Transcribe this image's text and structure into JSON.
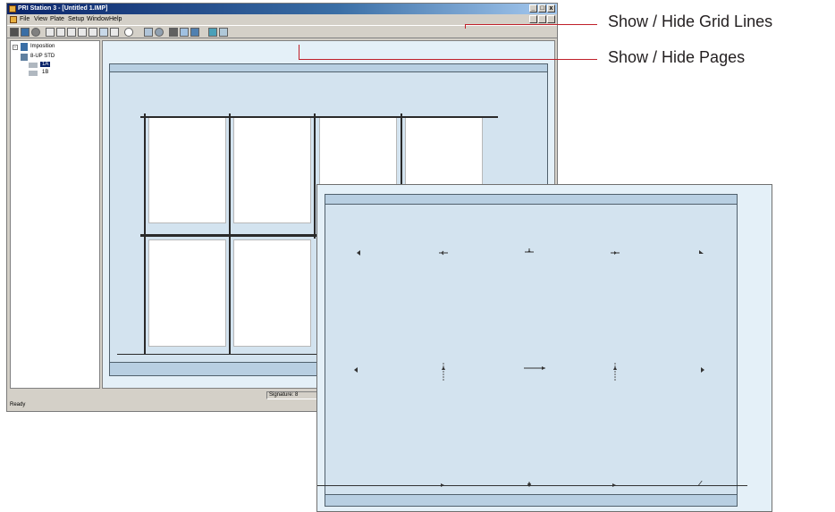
{
  "window": {
    "title": "PRI Station 3 - [Untitled 1.IMP]",
    "menu": [
      "File",
      "View",
      "Plate",
      "Setup",
      "Window",
      "Help"
    ],
    "controls": {
      "minimize": "_",
      "maximize": "□",
      "close": "x"
    }
  },
  "tree": {
    "root": "Imposition",
    "sheet": "8-UP STD",
    "pages": [
      "1A",
      "1B"
    ]
  },
  "statusbar": {
    "ready": "Ready",
    "signature": "Signature: 8"
  },
  "callouts": {
    "grid_lines": "Show / Hide Grid Lines",
    "pages": "Show / Hide Pages"
  },
  "colors": {
    "callout": "#c0202a",
    "plate": "#d3e3ef",
    "workspace": "#e4f0f8",
    "titlebar": "#0a246a"
  }
}
